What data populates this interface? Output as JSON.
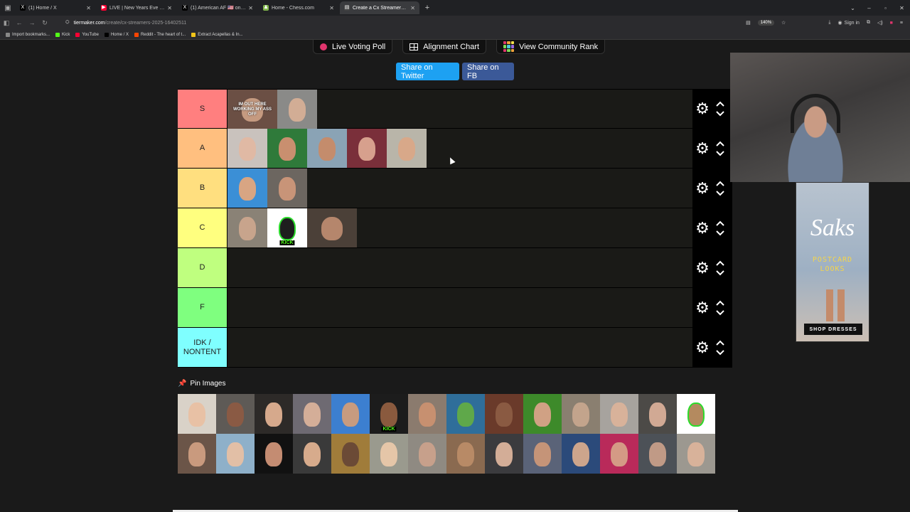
{
  "browser": {
    "tabs": [
      {
        "label": "(1) Home / X",
        "fav": "X",
        "fav_color": "#000000",
        "active": false
      },
      {
        "label": "LIVE | New Years Eve Celebratio",
        "fav": "▶",
        "fav_color": "#ff0033",
        "active": false
      },
      {
        "label": "(1) American AF 🇺🇸 on X: \"A mo",
        "fav": "X",
        "fav_color": "#000000",
        "active": false
      },
      {
        "label": "Home - Chess.com",
        "fav": "♟",
        "fav_color": "#81b64c",
        "active": false
      },
      {
        "label": "Create a Cx Streamers 2025 Tie",
        "fav": "▤",
        "fav_color": "#444444",
        "active": true
      }
    ],
    "url_host": "tiermaker.com",
    "url_path": "/create/cx-streamers-2025-16402511",
    "zoom": "140%",
    "signin": "Sign in",
    "bookmarks": [
      {
        "label": "Import bookmarks...",
        "color": "#888888"
      },
      {
        "label": "Kick",
        "color": "#53fc18"
      },
      {
        "label": "YouTube",
        "color": "#ff0033"
      },
      {
        "label": "Home / X",
        "color": "#000000"
      },
      {
        "label": "Reddit - The heart of t...",
        "color": "#ff4500"
      },
      {
        "label": "Extract Acapellas & In...",
        "color": "#f0c419"
      }
    ]
  },
  "toplinks": {
    "live_voting": "Live Voting Poll",
    "alignment": "Alignment Chart",
    "community": "View Community Rank"
  },
  "share": {
    "twitter": "Share on Twitter",
    "fb": "Share on FB"
  },
  "tiers": [
    {
      "label": "S",
      "color": "#ff7f7f",
      "items": [
        {
          "bg": "#6b4f44",
          "face": "#c59a80",
          "wide": true,
          "caption": "IM OUT HERE WORKING MY ASS OFF"
        },
        {
          "bg": "#8a8a88",
          "face": "#d2ad95"
        }
      ]
    },
    {
      "label": "A",
      "color": "#ffbf7f",
      "items": [
        {
          "bg": "#c9c2bd",
          "face": "#e0b9a4"
        },
        {
          "bg": "#2f7a3a",
          "face": "#c98f6f"
        },
        {
          "bg": "#8aa3b5",
          "face": "#c48c6c"
        },
        {
          "bg": "#7a2f3a",
          "face": "#d7a08d"
        },
        {
          "bg": "#b9b5a9",
          "face": "#d8a889"
        }
      ]
    },
    {
      "label": "B",
      "color": "#ffdf7f",
      "items": [
        {
          "bg": "#3b8fd6",
          "face": "#d8a583"
        },
        {
          "bg": "#6c6660",
          "face": "#c89478"
        }
      ]
    },
    {
      "label": "C",
      "color": "#ffff7f",
      "items": [
        {
          "bg": "#8a8276",
          "face": "#c8a48c"
        },
        {
          "bg": "#ffffff",
          "face": "#1e1e1e",
          "kick": "KICK",
          "ring": true
        },
        {
          "bg": "#4b4038",
          "face": "#b5866c",
          "wide": true
        }
      ]
    },
    {
      "label": "D",
      "color": "#bfff7f",
      "items": []
    },
    {
      "label": "F",
      "color": "#7fff7f",
      "items": []
    },
    {
      "label": "IDK / NONTENT",
      "color": "#7fffff",
      "items": []
    }
  ],
  "pin_images_label": "Pin Images",
  "pool": [
    {
      "bg": "#d9d2c8",
      "face": "#e8c1a5"
    },
    {
      "bg": "#5e5a56",
      "face": "#8a5a44"
    },
    {
      "bg": "#2d2a28",
      "face": "#d6a98c"
    },
    {
      "bg": "#6e6a72",
      "face": "#d4ae98"
    },
    {
      "bg": "#3c7fd0",
      "face": "#c79b7f"
    },
    {
      "bg": "#1c1c1c",
      "face": "#8a5a3e",
      "kick": "KICK"
    },
    {
      "bg": "#8b7b6e",
      "face": "#c79070"
    },
    {
      "bg": "#2f6e9a",
      "face": "#5fa84a"
    },
    {
      "bg": "#6a3a2a",
      "face": "#8a5a42"
    },
    {
      "bg": "#3d8a2a",
      "face": "#d0a184"
    },
    {
      "bg": "#8a7f70",
      "face": "#c3a48c"
    },
    {
      "bg": "#a7a39e",
      "face": "#d8b29a"
    },
    {
      "bg": "#4c4a47",
      "face": "#d1a994"
    },
    {
      "bg": "#ffffff",
      "face": "#b48a5f",
      "ring": true
    },
    {
      "bg": "#6b5548",
      "face": "#c99a7e"
    },
    {
      "bg": "#8eb0c9",
      "face": "#e2bfa6"
    },
    {
      "bg": "#111111",
      "face": "#c48c72"
    },
    {
      "bg": "#3a3a3a",
      "face": "#d7ab8c"
    },
    {
      "bg": "#a07c3a",
      "face": "#6b4a36"
    },
    {
      "bg": "#9a9a8e",
      "face": "#e5c6a8"
    },
    {
      "bg": "#8f8a82",
      "face": "#c7a08b"
    },
    {
      "bg": "#8a6a50",
      "face": "#b88a66"
    },
    {
      "bg": "#3b3b3e",
      "face": "#d3ad97"
    },
    {
      "bg": "#5a6378",
      "face": "#c59478"
    },
    {
      "bg": "#2b4a7a",
      "face": "#cda58c"
    },
    {
      "bg": "#b92a5a",
      "face": "#d49a85"
    },
    {
      "bg": "#4c5157",
      "face": "#c09a86"
    },
    {
      "bg": "#9c9890",
      "face": "#d8b29a"
    }
  ],
  "ad": {
    "brand": "Saks",
    "tagline_1": "POSTCARD",
    "tagline_2": "LOOKS",
    "button": "SHOP DRESSES"
  }
}
